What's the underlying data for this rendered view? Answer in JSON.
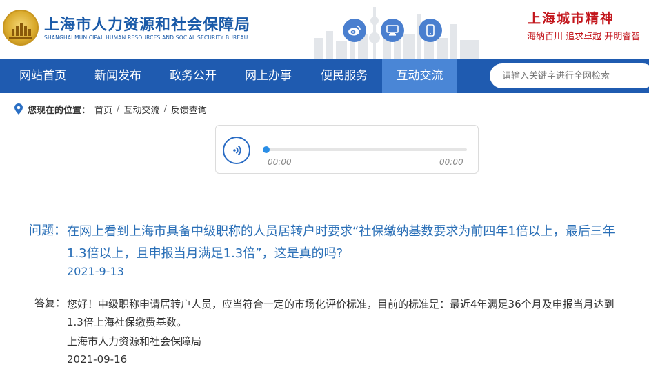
{
  "header": {
    "title": "上海市人力资源和社会保障局",
    "subtitle": "SHANGHAI MUNICIPAL HUMAN RESOURCES AND SOCIAL SECURITY BUREAU",
    "icons": [
      "weibo-icon",
      "monitor-icon",
      "mobile-icon"
    ],
    "slogan_title": "上海城市精神",
    "slogan_text": "海纳百川  追求卓越  开明睿智"
  },
  "nav": {
    "items": [
      {
        "label": "网站首页",
        "active": false
      },
      {
        "label": "新闻发布",
        "active": false
      },
      {
        "label": "政务公开",
        "active": false
      },
      {
        "label": "网上办事",
        "active": false
      },
      {
        "label": "便民服务",
        "active": false
      },
      {
        "label": "互动交流",
        "active": true
      }
    ],
    "search_placeholder": "请输入关键字进行全网检索"
  },
  "breadcrumb": {
    "prefix": "您现在的位置：",
    "items": [
      "首页",
      "互动交流",
      "反馈查询"
    ],
    "separator": "/"
  },
  "player": {
    "current_time": "00:00",
    "duration": "00:00",
    "progress": 0
  },
  "qa": {
    "question_label": "问题：",
    "question_text": "在网上看到上海市具备中级职称的人员居转户时要求“社保缴纳基数要求为前四年1倍以上，最后三年1.3倍以上，且申报当月满足1.3倍”，这是真的吗?",
    "question_date": "2021-9-13",
    "answer_label": "答复：",
    "answer_text": "您好！中级职称申请居转户人员，应当符合一定的市场化评价标准，目前的标准是：最近4年满足36个月及申报当月达到1.3倍上海社保缴费基数。",
    "answer_org": "上海市人力资源和社会保障局",
    "answer_date": "2021-09-16"
  },
  "colors": {
    "brand_blue": "#1f5bb0",
    "nav_active": "#4a86d6",
    "slogan_red": "#c3161c",
    "question_blue": "#2a6fb7"
  }
}
